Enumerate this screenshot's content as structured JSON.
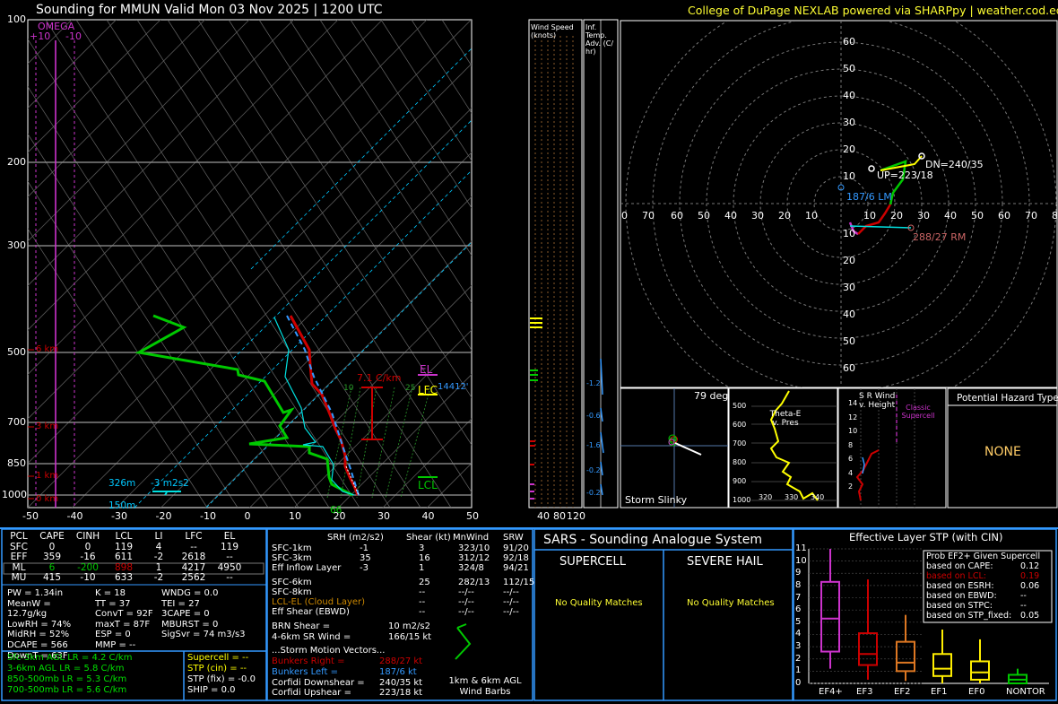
{
  "header": {
    "title": "Sounding for MMUN Valid  Mon 03 Nov 2025 | 1200 UTC",
    "credit": "College of DuPage NEXLAB powered via SHARPpy | weather.cod.edu"
  },
  "skewt": {
    "omega_label": "OMEGA",
    "omega_ticks": [
      "+10",
      "-10"
    ],
    "pressure_ticks": [
      "100",
      "200",
      "300",
      "500",
      "700",
      "850",
      "1000"
    ],
    "temp_ticks": [
      "-50",
      "-40",
      "-30",
      "-20",
      "-10",
      "0",
      "10",
      "20",
      "30",
      "40",
      "50"
    ],
    "height_marks": [
      "6 km",
      "3 km",
      "1 km",
      "0 km"
    ],
    "lapse_label": "7.1 C/km",
    "el_label": "EL",
    "lfc_label": "LFC",
    "lcl_label": "LCL",
    "lfc_height": "14412'",
    "srh_label_height": "326m",
    "srh_label_value": "-3 m2s2",
    "label_150m": "150m",
    "label_66": "66",
    "wetbulb_10": "10",
    "wetbulb_25": "25"
  },
  "wind_speed": {
    "title": "Wind Speed (knots)",
    "ticks": [
      "40",
      "80",
      "120"
    ]
  },
  "inf_temp": {
    "title": "Inf. Temp. Adv. (C/ hr)",
    "values": [
      "-1.2",
      "-0.6",
      "-1.6",
      "-0.2",
      "-0.2"
    ]
  },
  "hodograph": {
    "ring_labels_y_up": [
      "60",
      "50",
      "40",
      "30",
      "20",
      "10"
    ],
    "ring_labels_y_down": [
      "10",
      "20",
      "30",
      "40",
      "50",
      "60"
    ],
    "ring_labels_x": [
      "0",
      "70",
      "60",
      "50",
      "40",
      "30",
      "20",
      "10",
      "10",
      "20",
      "30",
      "40",
      "50",
      "60",
      "70",
      "8"
    ],
    "dn_label": "DN=240/35",
    "up_label": "UP=223/18",
    "lm_label": "187/6 LM",
    "rm_label": "288/27 RM"
  },
  "storm_slinky": {
    "label": "Storm Slinky",
    "deg": "79 deg"
  },
  "theta_e": {
    "title": "Theta-E v. Pres",
    "y_ticks": [
      "500",
      "600",
      "700",
      "800",
      "900",
      "1000"
    ],
    "x_ticks": [
      "320",
      "330",
      "340"
    ]
  },
  "srwind": {
    "title": "S R Wind v. Height",
    "y_ticks": [
      "14",
      "12",
      "10",
      "8",
      "6",
      "4",
      "2"
    ],
    "note": "Classic Supercell"
  },
  "hazard": {
    "title": "Potential Hazard Type",
    "value": "NONE"
  },
  "parcel_table": {
    "headers": [
      "PCL",
      "CAPE",
      "CINH",
      "LCL",
      "LI",
      "LFC",
      "EL"
    ],
    "rows": [
      [
        "SFC",
        "0",
        "0",
        "119",
        "4",
        "--",
        "119"
      ],
      [
        "EFF",
        "359",
        "-16",
        "611",
        "-2",
        "2618",
        "--"
      ],
      [
        "ML",
        "6",
        "-200",
        "898",
        "1",
        "4217",
        "4950"
      ],
      [
        "MU",
        "415",
        "-10",
        "633",
        "-2",
        "2562",
        "--"
      ]
    ]
  },
  "indices": {
    "col1": [
      "PW = 1.34in",
      "MeanW = 12.7g/kg",
      "LowRH = 74%",
      "MidRH = 52%",
      "DCAPE = 566",
      "DownT = 63F"
    ],
    "col2": [
      "K = 18",
      "TT = 37",
      "ConvT = 92F",
      "maxT = 87F",
      "ESP = 0",
      "MMP = --"
    ],
    "col3": [
      "WNDG = 0.0",
      "TEI = 27",
      "3CAPE = 0",
      "MBURST = 0",
      "",
      "SigSvr = 74 m3/s3"
    ]
  },
  "lapse_rates": [
    "Sfc-3km AGL LR = 4.2 C/km",
    "3-6km AGL LR = 5.8 C/km",
    "850-500mb LR = 5.3 C/km",
    "700-500mb LR = 5.6 C/km"
  ],
  "composite": [
    "Supercell = --",
    "STP (cin) = --",
    "STP (fix) = -0.0",
    "SHIP = 0.0"
  ],
  "kinematics": {
    "headers": [
      "SRH (m2/s2)",
      "Shear (kt)",
      "MnWind",
      "SRW"
    ],
    "rows": [
      [
        "SFC-1km",
        "-1",
        "3",
        "323/10",
        "91/20"
      ],
      [
        "SFC-3km",
        "35",
        "16",
        "312/12",
        "92/18"
      ],
      [
        "Eff Inflow Layer",
        "-3",
        "1",
        "324/8",
        "94/21"
      ],
      [
        "SFC-6km",
        "",
        "25",
        "282/13",
        "112/15"
      ],
      [
        "SFC-8km",
        "",
        "--",
        "--/--",
        "--/--"
      ],
      [
        "LCL-EL (Cloud Layer)",
        "",
        "--",
        "--/--",
        "--/--"
      ],
      [
        "Eff Shear (EBWD)",
        "",
        "--",
        "--/--",
        "--/--"
      ]
    ],
    "brn_shear": "BRN Shear =",
    "brn_value": "10 m2/s2",
    "sr_wind": "4-6km SR Wind =",
    "sr_value": "166/15 kt",
    "storm_motion": "...Storm Motion Vectors...",
    "vectors": [
      [
        "Bunkers Right =",
        "288/27 kt"
      ],
      [
        "Bunkers Left =",
        "187/6 kt"
      ],
      [
        "Corfidi Downshear =",
        "240/35 kt"
      ],
      [
        "Corfidi Upshear =",
        "223/18 kt"
      ]
    ],
    "barb_caption": "1km & 6km AGL Wind Barbs"
  },
  "sars": {
    "title": "SARS - Sounding Analogue System",
    "supercell": "SUPERCELL",
    "hail": "SEVERE HAIL",
    "supercell_match": "No Quality Matches",
    "hail_match": "No Quality Matches"
  },
  "stp": {
    "title": "Effective Layer STP (with CIN)",
    "y_ticks": [
      "11",
      "10",
      "9",
      "8",
      "7",
      "6",
      "5",
      "4",
      "3",
      "2",
      "1",
      "0"
    ],
    "categories": [
      "EF4+",
      "EF3",
      "EF2",
      "EF1",
      "EF0",
      "NONTOR"
    ],
    "prob_title": "Prob EF2+ Given Supercell",
    "prob_rows": [
      [
        "based on CAPE:",
        "0.12"
      ],
      [
        "based on LCL:",
        "0.19"
      ],
      [
        "based on ESRH:",
        "0.06"
      ],
      [
        "based on EBWD:",
        "--"
      ],
      [
        "based on STPC:",
        "--"
      ],
      [
        "based on STP_fixed:",
        "0.05"
      ]
    ]
  },
  "chart_data": {
    "type": "line",
    "title": "Sounding for MMUN Valid  Mon 03 Nov 2025 | 1200 UTC",
    "xlabel": "",
    "ylabel": "",
    "ylim": [
      1000,
      100
    ],
    "xlim": [
      -50,
      50
    ],
    "stp_boxes": [
      {
        "category": "EF4+",
        "min": 1.2,
        "q1": 2.6,
        "median": 5.3,
        "q3": 8.3,
        "max": 11.0
      },
      {
        "category": "EF3",
        "min": 0.3,
        "q1": 1.5,
        "median": 2.4,
        "q3": 4.1,
        "max": 8.5
      },
      {
        "category": "EF2",
        "min": 0.2,
        "q1": 1.0,
        "median": 1.7,
        "q3": 3.4,
        "max": 5.6
      },
      {
        "category": "EF1",
        "min": 0.0,
        "q1": 0.6,
        "median": 1.2,
        "q3": 2.4,
        "max": 4.4
      },
      {
        "category": "EF0",
        "min": 0.0,
        "q1": 0.3,
        "median": 0.9,
        "q3": 1.8,
        "max": 3.6
      },
      {
        "category": "NONTOR",
        "min": 0.0,
        "q1": 0.0,
        "median": 0.3,
        "q3": 0.7,
        "max": 1.2
      }
    ]
  }
}
